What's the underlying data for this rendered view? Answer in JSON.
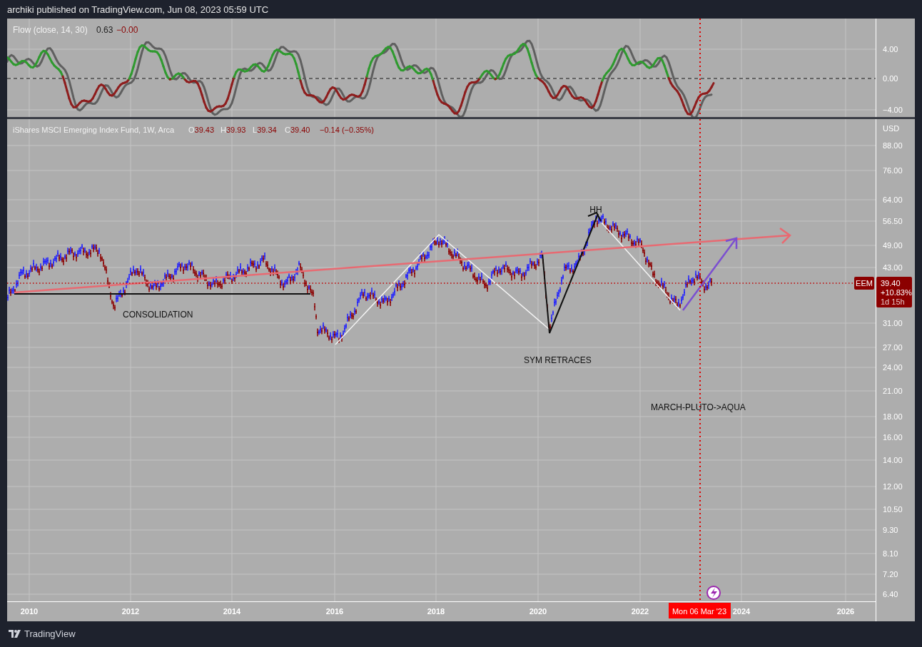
{
  "header": {
    "text": "archiki published on TradingView.com, Jun 08, 2023 05:59 UTC"
  },
  "indicator_pane": {
    "legend": {
      "name": "Flow (close, 14, 30)",
      "value": "0.63",
      "change": "−0.00"
    },
    "axis_labels": [
      "4.00",
      "0.00",
      "−4.00"
    ]
  },
  "price_pane": {
    "legend": {
      "symbol": "iShares MSCI Emerging Index Fund, 1W, Arca",
      "ohlc": [
        {
          "label": "O",
          "value": "39.43"
        },
        {
          "label": "H",
          "value": "39.93"
        },
        {
          "label": "L",
          "value": "39.34"
        },
        {
          "label": "C",
          "value": "39.40"
        }
      ],
      "change": "−0.14 (−0.35%)"
    },
    "currency": "USD",
    "axis_labels": [
      "88.00",
      "76.00",
      "64.00",
      "56.50",
      "49.00",
      "43.00",
      "31.00",
      "27.00",
      "24.00",
      "21.00",
      "18.00",
      "16.00",
      "14.00",
      "12.00",
      "10.50",
      "9.30",
      "8.10",
      "7.20",
      "6.40"
    ],
    "annotations": [
      {
        "text": "CONSOLIDATION"
      },
      {
        "text": "SYM RETRACES"
      },
      {
        "text": "HH"
      },
      {
        "text": "MARCH-PLUTO->AQUA"
      }
    ],
    "price_tag": {
      "symbol": "EEM",
      "price": "39.40",
      "change": "+10.83%",
      "countdown": "1d 15h"
    }
  },
  "time_axis": {
    "labels": [
      "2010",
      "2012",
      "2014",
      "2016",
      "2018",
      "2020",
      "2022",
      "2024",
      "2026"
    ],
    "crosshair_label": "Mon 06 Mar '23"
  },
  "footer": {
    "brand": "TradingView"
  }
}
